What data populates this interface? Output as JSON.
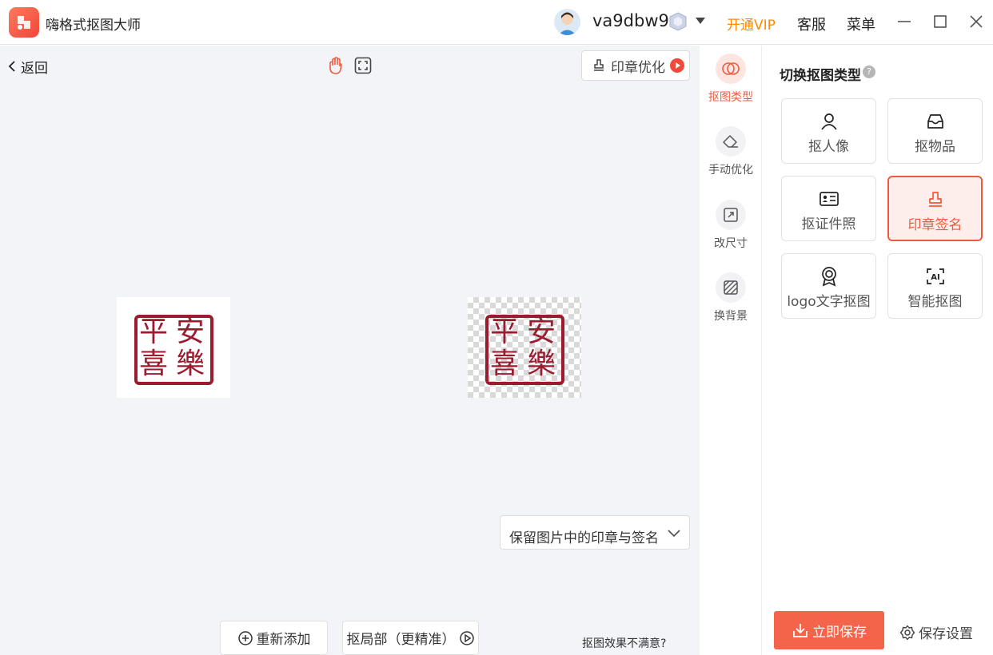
{
  "app": {
    "title": "嗨格式抠图大师"
  },
  "user": {
    "name": "va9dbw9"
  },
  "header": {
    "vip": "开通VIP",
    "service": "客服",
    "menu": "菜单"
  },
  "canvas": {
    "back": "返回",
    "stamp_optimize": "印章优化",
    "keep_select_value": "保留图片中的印章与签名",
    "readd": "重新添加",
    "partial": "抠局部（更精准）",
    "unsatisfied": "抠图效果不满意?",
    "seal_chars": [
      "安",
      "平",
      "樂",
      "喜"
    ]
  },
  "rail": [
    {
      "label": "抠图类型",
      "icon": "cutout-type-icon"
    },
    {
      "label": "手动优化",
      "icon": "eraser-icon"
    },
    {
      "label": "改尺寸",
      "icon": "resize-icon"
    },
    {
      "label": "换背景",
      "icon": "background-icon"
    }
  ],
  "panel": {
    "title": "切换抠图类型",
    "types": [
      {
        "label": "抠人像",
        "icon": "person-icon"
      },
      {
        "label": "抠物品",
        "icon": "inbox-icon"
      },
      {
        "label": "抠证件照",
        "icon": "id-card-icon"
      },
      {
        "label": "印章签名",
        "icon": "stamp-icon"
      },
      {
        "label": "logo文字抠图",
        "icon": "badge-icon"
      },
      {
        "label": "智能抠图",
        "icon": "ai-icon"
      }
    ],
    "active_type": "印章签名",
    "save": "立即保存",
    "save_settings": "保存设置"
  },
  "colors": {
    "accent": "#f05a3c",
    "vip": "#ff8a00",
    "seal": "#9b1b2f"
  }
}
